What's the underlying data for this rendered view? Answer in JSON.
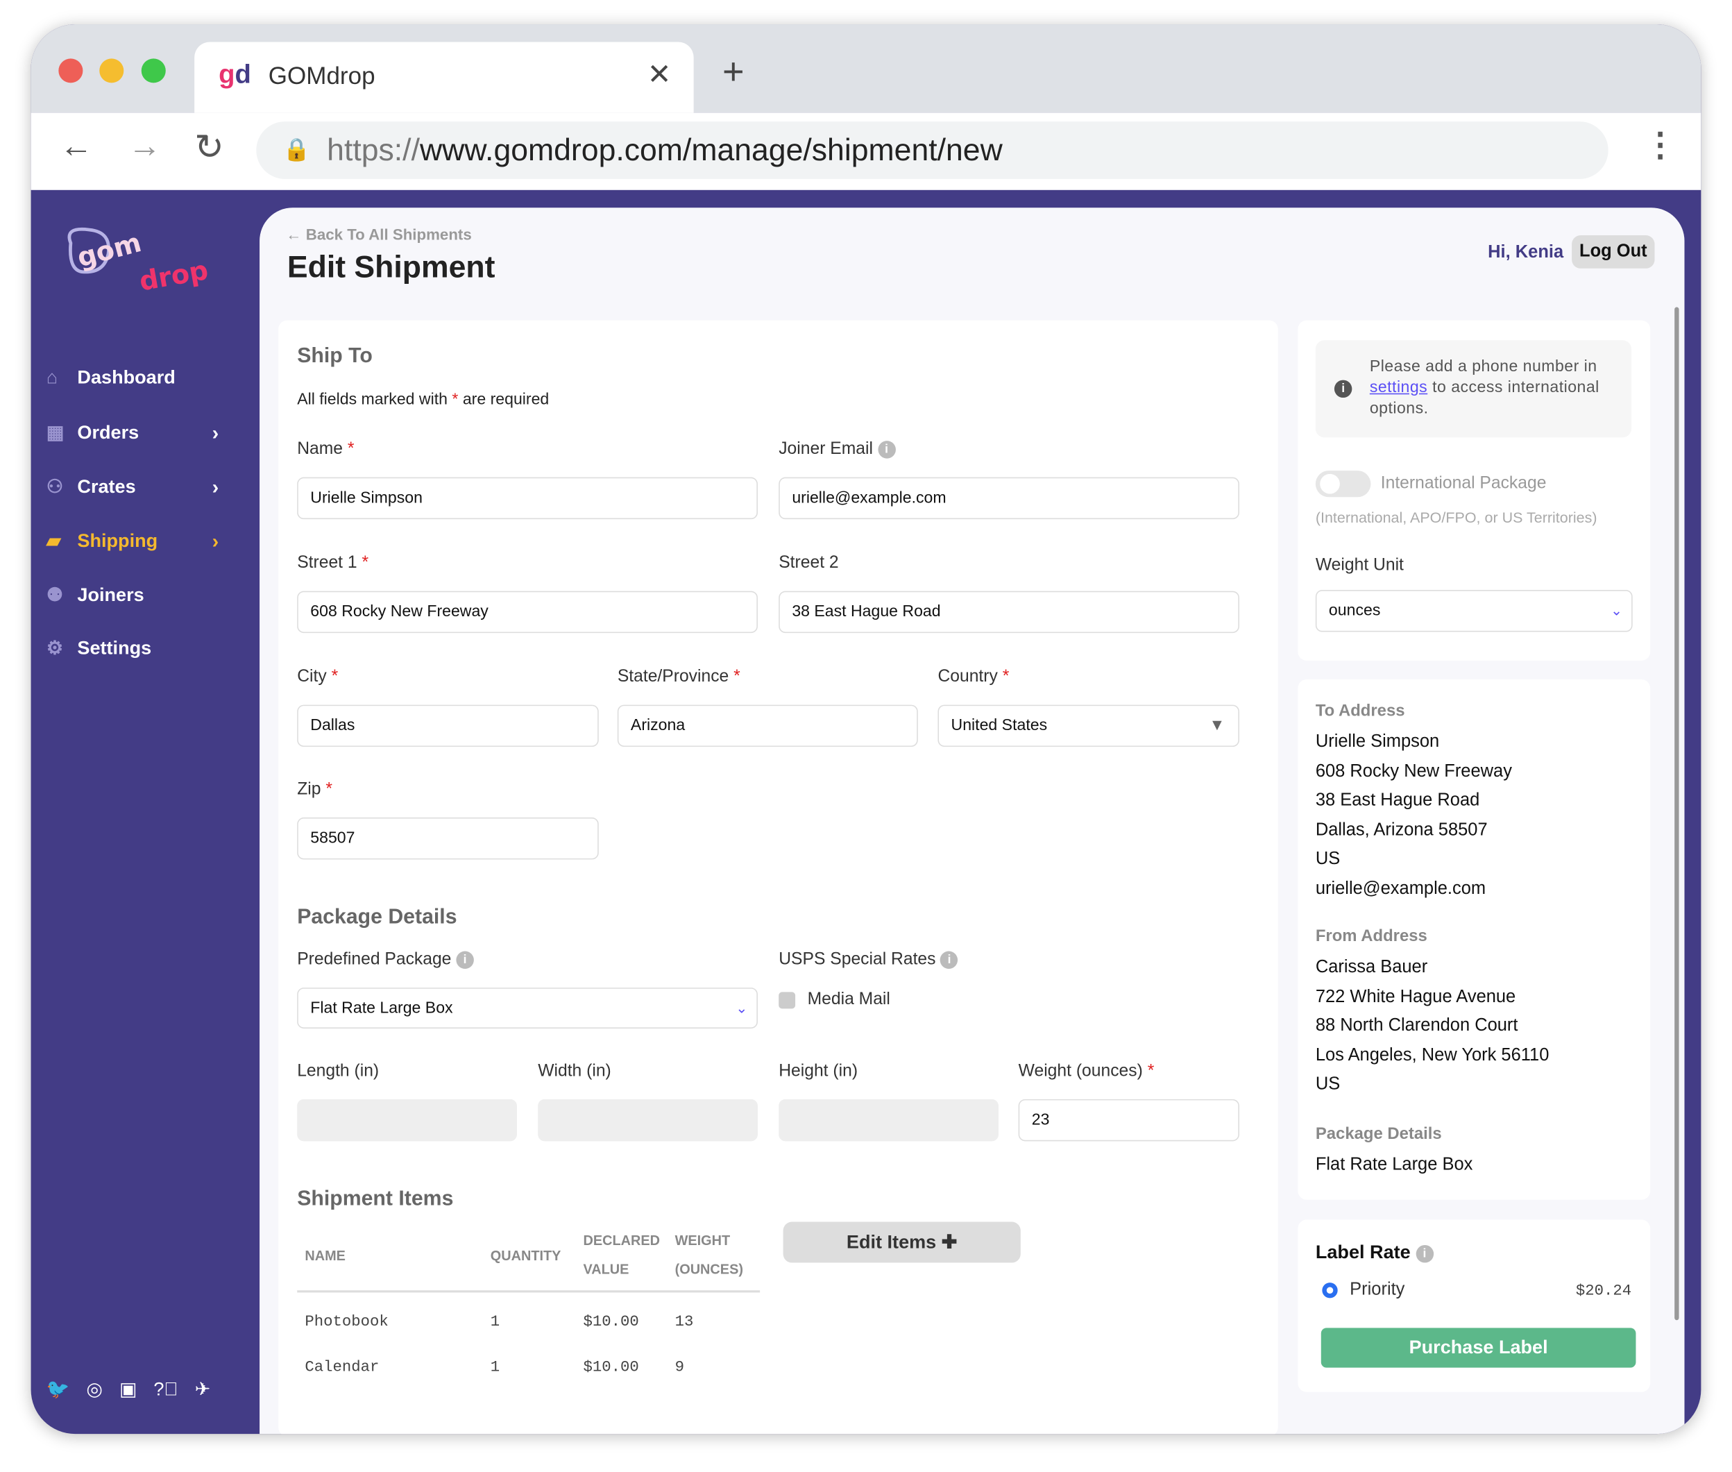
{
  "browser": {
    "tab_title": "GOMdrop",
    "url_prefix": "https://",
    "url_rest": "www.gomdrop.com/manage/shipment/new"
  },
  "sidebar": {
    "logo_text": "gomdrop",
    "items": [
      {
        "label": "Dashboard",
        "icon": "home-icon"
      },
      {
        "label": "Orders",
        "icon": "grid-icon"
      },
      {
        "label": "Crates",
        "icon": "crates-icon"
      },
      {
        "label": "Shipping",
        "icon": "box-icon",
        "active": true
      },
      {
        "label": "Joiners",
        "icon": "users-icon"
      },
      {
        "label": "Settings",
        "icon": "gear-icon"
      }
    ],
    "footer_icons": [
      "twitter-icon",
      "instagram-icon",
      "discord-icon",
      "help-icon",
      "plane-icon"
    ]
  },
  "header": {
    "back_link": "Back To All Shipments",
    "title": "Edit Shipment",
    "greeting": "Hi, Kenia",
    "logout": "Log Out"
  },
  "ship_to": {
    "title": "Ship To",
    "required_note_pre": "All fields marked with",
    "required_note_star": "*",
    "required_note_post": "are required",
    "fields": {
      "name": {
        "label": "Name",
        "value": "Urielle Simpson"
      },
      "joiner_email": {
        "label": "Joiner Email",
        "value": "urielle@example.com"
      },
      "street1": {
        "label": "Street 1",
        "value": "608 Rocky New Freeway"
      },
      "street2": {
        "label": "Street 2",
        "value": "38 East Hague Road"
      },
      "city": {
        "label": "City",
        "value": "Dallas"
      },
      "state": {
        "label": "State/Province",
        "value": "Arizona"
      },
      "country": {
        "label": "Country",
        "value": "United States"
      },
      "zip": {
        "label": "Zip",
        "value": "58507"
      }
    }
  },
  "package": {
    "title": "Package Details",
    "predefined_label": "Predefined Package",
    "predefined_value": "Flat Rate Large Box",
    "usps_label": "USPS Special Rates",
    "media_mail": "Media Mail",
    "length_label": "Length (in)",
    "width_label": "Width (in)",
    "height_label": "Height (in)",
    "weight_label": "Weight (ounces)",
    "weight_value": "23"
  },
  "items": {
    "title": "Shipment Items",
    "edit_button": "Edit Items",
    "headers": {
      "name": "NAME",
      "quantity": "QUANTITY",
      "declared1": "DECLARED",
      "declared2": "VALUE",
      "weight1": "WEIGHT",
      "weight2": "(OUNCES)"
    },
    "rows": [
      {
        "name": "Photobook",
        "quantity": "1",
        "value": "$10.00",
        "weight": "13"
      },
      {
        "name": "Calendar",
        "quantity": "1",
        "value": "$10.00",
        "weight": "9"
      }
    ]
  },
  "options": {
    "notice_pre": "Please add a phone number in",
    "notice_link": "settings",
    "notice_post": "to access international options.",
    "intl_label": "International Package",
    "intl_sub": "(International, APO/FPO, or US Territories)",
    "weight_unit_label": "Weight Unit",
    "weight_unit_value": "ounces"
  },
  "summary": {
    "to_title": "To Address",
    "to_lines": [
      "Urielle Simpson",
      "608 Rocky New Freeway",
      "38 East Hague Road",
      "Dallas, Arizona 58507",
      "US",
      "urielle@example.com"
    ],
    "from_title": "From Address",
    "from_lines": [
      "Carissa Bauer",
      "722 White Hague Avenue",
      "88 North Clarendon Court",
      "Los Angeles, New York 56110",
      "US"
    ],
    "pkg_title": "Package Details",
    "pkg_value": "Flat Rate Large Box"
  },
  "rate": {
    "title": "Label Rate",
    "option": "Priority",
    "price": "$20.24",
    "purchase": "Purchase Label"
  },
  "colors": {
    "purple": "#433c86",
    "active": "#f5b92e",
    "green": "#5cb88a",
    "link": "#5b4ff5"
  }
}
